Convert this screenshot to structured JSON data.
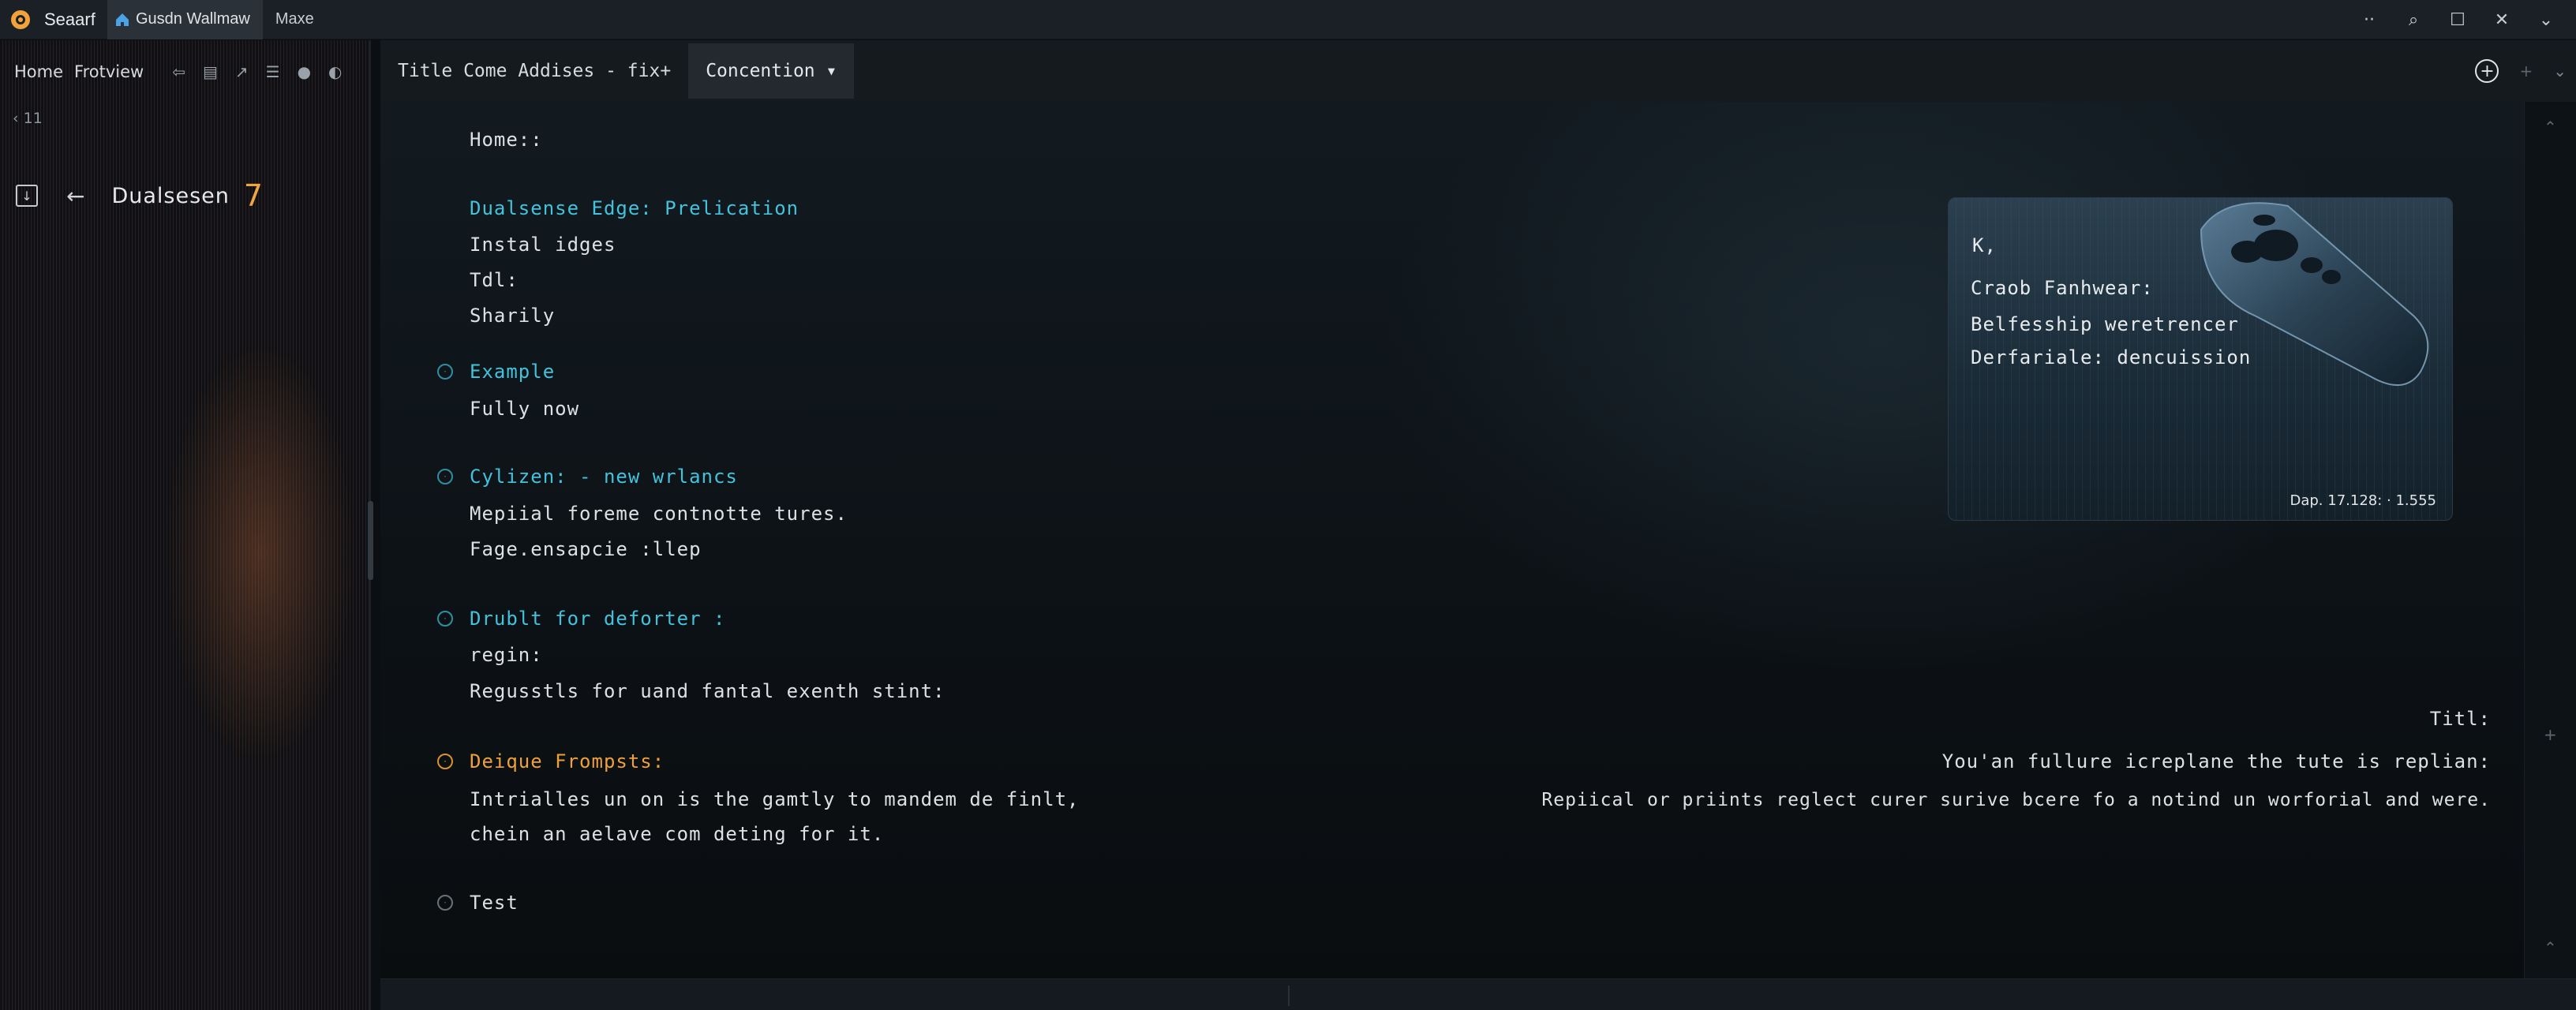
{
  "window": {
    "app_name": "Seaarf",
    "tabs": [
      {
        "label": "Gusdn Wallmaw",
        "icon": "home-icon",
        "active": true
      },
      {
        "label": "Maxe",
        "active": false
      }
    ],
    "controls": {
      "more": "··",
      "search": "⌕",
      "maximize": "☐",
      "close": "✕",
      "chevron": "⌄"
    }
  },
  "sidebar": {
    "nav": {
      "home": "Home",
      "frotview": "Frotview"
    },
    "count": "‹ 11",
    "header": {
      "title": "Dualsesen",
      "number": "7"
    }
  },
  "editor_tabs": {
    "tabs": [
      {
        "label": "Title  Come Addises  -  fix+"
      },
      {
        "label": "Concention ▾"
      }
    ]
  },
  "content": {
    "home": "Home::",
    "heading1": "Dualsense Edge: Prelication",
    "lines1": [
      "Instal idges",
      "Tdl:",
      "Sharily"
    ],
    "section1": {
      "title": "Example",
      "lines": [
        "Fully now"
      ]
    },
    "section2": {
      "title": "Cylizen: - new wrlancs",
      "lines": [
        "Mepiial foreme contnotte tures.",
        "Fage.ensapcie :llep"
      ]
    },
    "section3": {
      "title": "Drublt for deforter :",
      "lines": [
        "regin:",
        "Regusstls for uand fantal exenth stint:"
      ]
    },
    "section4": {
      "title": "Deique Frompsts:",
      "lines": [
        "Intrialles un on is the gamtly to mandem de finlt,",
        "chein an aelave com deting for it."
      ]
    },
    "section5": {
      "title": "Test"
    },
    "right": {
      "title": "Titl:",
      "line1": "You'an fullure icreplane the tute is replian:",
      "line2": "Repiical or priints reglect curer surive bcere fo a notind un worforial and were."
    }
  },
  "card": {
    "k": "K,",
    "line1": "Craob Fanhwear:",
    "line2": "Belfesship weretrencer",
    "line3": "Derfariale: dencuission",
    "meta": "Dap. 17.128: ·  1.555"
  }
}
